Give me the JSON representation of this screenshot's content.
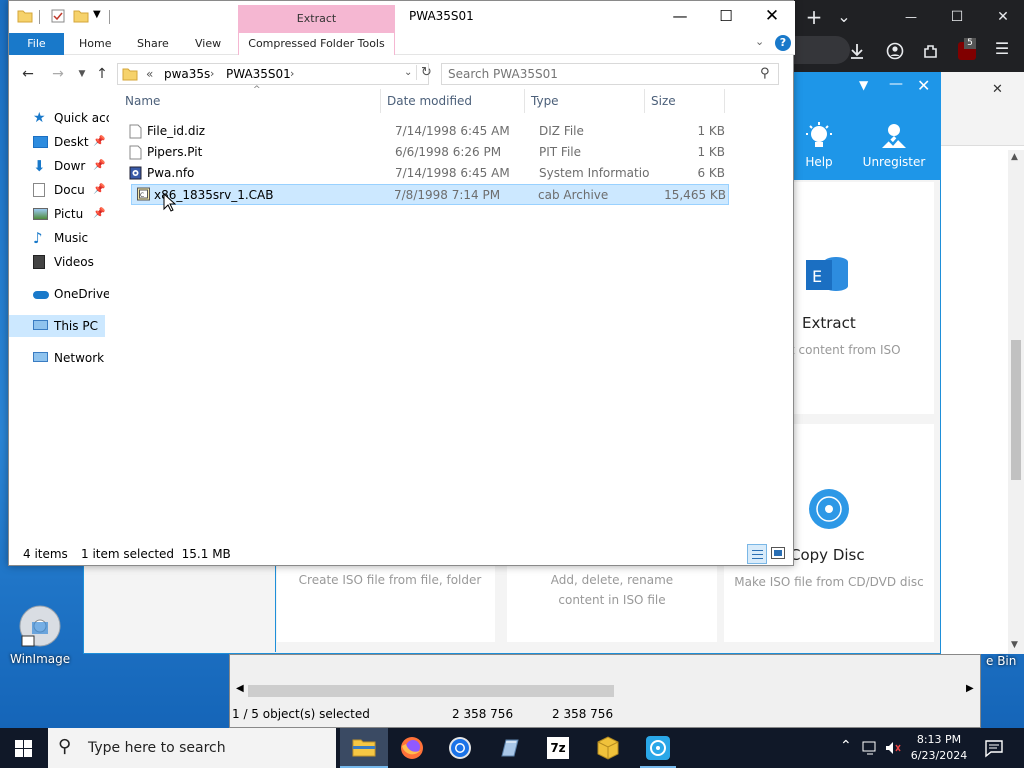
{
  "browser": {
    "new_tab": "+",
    "tab_list": "⌄",
    "minimize": "—",
    "maximize": "☐",
    "close": "✕",
    "extension_badge": "5",
    "side_close": "✕"
  },
  "iso_app": {
    "help_label": "Help",
    "unregister_label": "Unregister",
    "extract_title": "Extract",
    "extract_desc": "t content from ISO",
    "copy_disc_title": "Copy Disc",
    "create_desc": "Create ISO file from file, folder",
    "edit_desc_line1": "Add, delete, rename",
    "edit_desc_line2": "content in ISO file",
    "copy_desc": "Make ISO file from CD/DVD disc"
  },
  "winimage": {
    "status_selected": "1 / 5 object(s) selected",
    "status_size1": "2 358 756",
    "status_size2": "2 358 756",
    "recycle_fragment": "e Bin"
  },
  "desktop": {
    "winimage_label": "WinImage"
  },
  "explorer": {
    "extract_tab": "Extract",
    "window_title": "PWA35S01",
    "ribbon": {
      "file": "File",
      "home": "Home",
      "share": "Share",
      "view": "View",
      "compressed_tools": "Compressed Folder Tools"
    },
    "address": {
      "prefix": "«",
      "crumb1": "pwa35s",
      "crumb2": "PWA35S01"
    },
    "search_placeholder": "Search PWA35S01",
    "nav": [
      {
        "label": "Quick acc",
        "pinned": false
      },
      {
        "label": "Deskt",
        "pinned": true
      },
      {
        "label": "Dowr",
        "pinned": true
      },
      {
        "label": "Docu",
        "pinned": true
      },
      {
        "label": "Pictu",
        "pinned": true
      },
      {
        "label": "Music",
        "pinned": false
      },
      {
        "label": "Videos",
        "pinned": false
      },
      {
        "label": "OneDrive",
        "pinned": false
      },
      {
        "label": "This PC",
        "pinned": false
      },
      {
        "label": "Network",
        "pinned": false
      }
    ],
    "columns": {
      "name": "Name",
      "date": "Date modified",
      "type": "Type",
      "size": "Size"
    },
    "files": [
      {
        "name": "File_id.diz",
        "date": "7/14/1998 6:45 AM",
        "type": "DIZ File",
        "size": "1 KB"
      },
      {
        "name": "Pipers.Pit",
        "date": "6/6/1998 6:26 PM",
        "type": "PIT File",
        "size": "1 KB"
      },
      {
        "name": "Pwa.nfo",
        "date": "7/14/1998 6:45 AM",
        "type": "System Informatio...",
        "size": "6 KB"
      },
      {
        "name": "x86_1835srv_1.CAB",
        "date": "7/8/1998 7:14 PM",
        "type": "cab Archive",
        "size": "15,465 KB"
      }
    ],
    "status": {
      "items": "4 items",
      "selected": "1 item selected  15.1 MB"
    }
  },
  "taskbar": {
    "search_placeholder": "Type here to search",
    "time": "8:13 PM",
    "date": "6/23/2024",
    "sevenzip_label": "7z"
  }
}
